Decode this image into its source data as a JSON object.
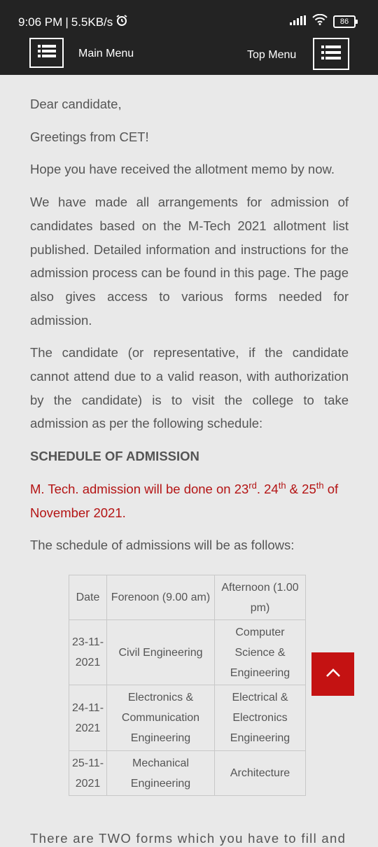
{
  "status": {
    "time": "9:06 PM",
    "separator": "|",
    "speed": "5.5KB/s",
    "battery": "86"
  },
  "nav": {
    "main_menu": "Main Menu",
    "top_menu": "Top Menu"
  },
  "body": {
    "greeting": "Dear candidate,",
    "greetings_line": "Greetings from CET!",
    "memo_line": "Hope you have received the allotment memo by now.",
    "para1": "We have made all arrangements for admission of candidates based on the M-Tech 2021 allotment list published.  Detailed information and instructions for the admission process can be found in this page. The page also gives access to various forms needed for admission.",
    "para2": "The candidate (or representative, if the candidate cannot attend due to a valid reason, with authorization by the candidate) is to visit the college to take admission as per the following schedule:",
    "schedule_heading": "SCHEDULE OF ADMISSION",
    "admission_prefix": "M. Tech. admission will be done on 23",
    "sup1": "rd",
    "mid1": ". 24",
    "sup2": "th",
    "mid2": " & 25",
    "sup3": "th",
    "admission_suffix": " of November 2021.",
    "schedule_intro": "The schedule of admissions will be as follows:",
    "cutoff_text": "There are TWO forms which you have to fill and"
  },
  "table": {
    "headers": [
      "Date",
      "Forenoon (9.00 am)",
      "Afternoon (1.00 pm)"
    ],
    "rows": [
      [
        "23-11-2021",
        "Civil Engineering",
        "Computer Science & Engineering"
      ],
      [
        "24-11-2021",
        "Electronics & Communication Engineering",
        "Electrical & Electronics Engineering"
      ],
      [
        "25-11-2021",
        "Mechanical Engineering",
        "Architecture"
      ]
    ]
  },
  "colors": {
    "bar": "#232323",
    "accent": "#c41212",
    "text": "#555555"
  },
  "icons": {
    "menu": "list-menu-icon",
    "scroll_top": "chevron-up-icon",
    "wifi": "wifi-icon",
    "signal": "signal-icon",
    "alarm": "alarm-icon"
  }
}
